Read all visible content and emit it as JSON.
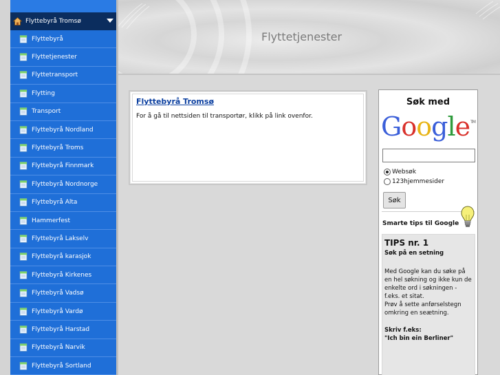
{
  "sidebar": {
    "header_label": "Flyttebyrå Tromsø",
    "items": [
      {
        "label": "Flyttebyrå"
      },
      {
        "label": "Flyttetjenester"
      },
      {
        "label": "Flyttetransport"
      },
      {
        "label": "Flytting"
      },
      {
        "label": "Transport"
      },
      {
        "label": "Flyttebyrå Nordland"
      },
      {
        "label": "Flyttebyrå Troms"
      },
      {
        "label": "Flyttebyrå Finnmark"
      },
      {
        "label": "Flyttebyrå Nordnorge"
      },
      {
        "label": "Flyttebyrå Alta"
      },
      {
        "label": "Hammerfest"
      },
      {
        "label": "Flyttebyrå Lakselv"
      },
      {
        "label": "Flyttebyrå karasjok"
      },
      {
        "label": "Flyttebyrå Kirkenes"
      },
      {
        "label": "Flyttebyrå Vadsø"
      },
      {
        "label": "Flyttebyrå Vardø"
      },
      {
        "label": "Flyttebyrå Harstad"
      },
      {
        "label": "Flyttebyrå Narvik"
      },
      {
        "label": "Flyttebyrå Sortland"
      }
    ]
  },
  "banner": {
    "title": "Flyttetjenester"
  },
  "content": {
    "link_text": "Flyttebyrå Tromsø",
    "body_text": "For å gå til nettsiden til transportør, klikk på link ovenfor."
  },
  "search": {
    "title": "Søk med",
    "logo_text": "Google",
    "logo_tm": "TM",
    "input_value": "",
    "radio_options": [
      {
        "label": "Websøk",
        "checked": true
      },
      {
        "label": "123hjemmesider",
        "checked": false
      }
    ],
    "button_label": "Søk"
  },
  "tips": {
    "header": "Smarte tips til Google",
    "title": "TIPS nr. 1",
    "subtitle": "Søk på en setning",
    "body_lines": [
      "Med Google kan du søke på",
      "en hel søkning og ikke kun de",
      "enkelte ord i søkningen -",
      "f.eks. et sitat.",
      "Prøv å sette anførselstegn",
      "omkring en seætning."
    ],
    "example_label": "Skriv f.eks:",
    "example": "\"Ich bin ein Berliner\""
  },
  "colors": {
    "sidebar_bg": "#1f6fd8",
    "sidebar_header_bg": "#0b2d5e",
    "link": "#0b3fa0",
    "google_blue": "#3b5fd9",
    "google_red": "#d9312b",
    "google_yellow": "#e8b417",
    "google_green": "#2f9b3c"
  }
}
